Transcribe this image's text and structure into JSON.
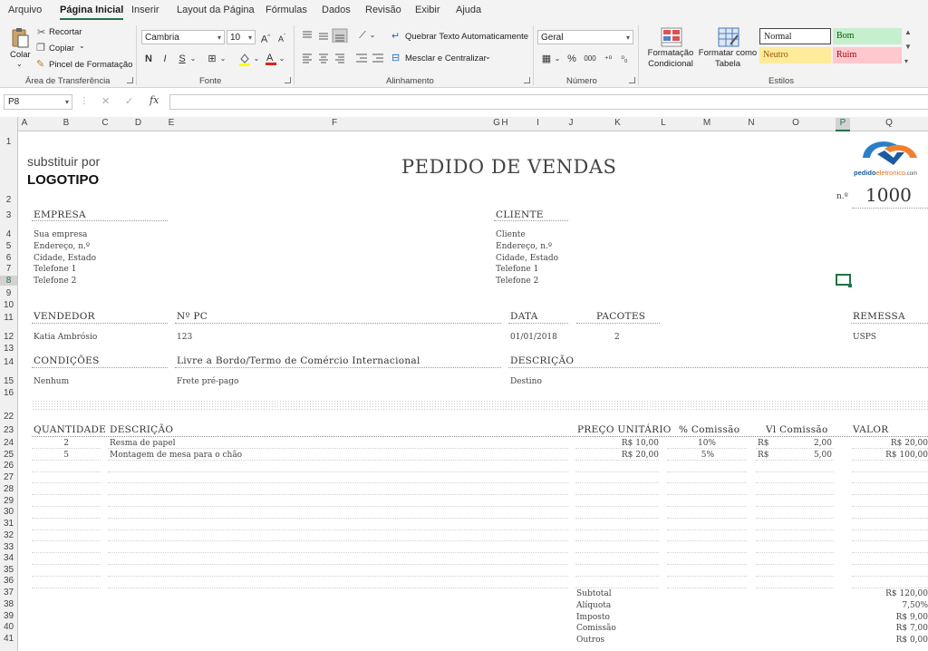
{
  "menu": {
    "tabs": [
      "Arquivo",
      "Página Inicial",
      "Inserir",
      "Layout da Página",
      "Fórmulas",
      "Dados",
      "Revisão",
      "Exibir",
      "Ajuda"
    ],
    "active": "Página Inicial"
  },
  "ribbon": {
    "clipboard": {
      "paste": "Colar",
      "cut": "Recortar",
      "copy": "Copiar",
      "painter": "Pincel de Formatação",
      "group": "Área de Transferência"
    },
    "font": {
      "name": "Cambria",
      "size": "10",
      "bold": "N",
      "italic": "I",
      "underline": "S",
      "group": "Fonte"
    },
    "alignment": {
      "wrap": "Quebrar Texto Automaticamente",
      "merge": "Mesclar e Centralizar",
      "group": "Alinhamento"
    },
    "number": {
      "format": "Geral",
      "group": "Número",
      "pct": "%",
      "thousands": "000"
    },
    "styles": {
      "cond": "Formatação Condicional",
      "table": "Formatar como Tabela",
      "normal": "Normal",
      "good": "Bom",
      "neutral": "Neutro",
      "bad": "Ruim",
      "group": "Estilos"
    }
  },
  "formula_bar": {
    "cell_ref": "P8",
    "content": ""
  },
  "columns": [
    "A",
    "B",
    "C",
    "D",
    "E",
    "F",
    "G",
    "H",
    "I",
    "J",
    "K",
    "L",
    "M",
    "N",
    "O",
    "P",
    "Q"
  ],
  "rows": [
    "1",
    "2",
    "3",
    "4",
    "5",
    "6",
    "7",
    "8",
    "9",
    "10",
    "11",
    "12",
    "13",
    "14",
    "15",
    "16",
    "22",
    "23",
    "24",
    "25",
    "26",
    "27",
    "28",
    "29",
    "30",
    "31",
    "32",
    "33",
    "34",
    "35",
    "36",
    "37",
    "38",
    "39",
    "40",
    "41"
  ],
  "sheet": {
    "logo_hint1": "substituir por",
    "logo_hint2": "LOGOTIPO",
    "title": "PEDIDO DE VENDAS",
    "brand": "pedido",
    "brand2": "eletronico",
    "brand3": ".com",
    "num_label": "n.º",
    "number": "1000",
    "empresa": {
      "label": "EMPRESA",
      "lines": [
        "Sua empresa",
        "Endereço, n.º",
        "Cidade, Estado",
        "Telefone 1",
        "Telefone 2"
      ]
    },
    "cliente": {
      "label": "CLIENTE",
      "lines": [
        "Cliente",
        "Endereço, n.º",
        "Cidade, Estado",
        "Telefone 1",
        "Telefone 2"
      ]
    },
    "vendedor": {
      "label": "VENDEDOR",
      "value": "Katia Ambrósio"
    },
    "npc": {
      "label": "Nº PC",
      "value": "123"
    },
    "data": {
      "label": "DATA",
      "value": "01/01/2018"
    },
    "pacotes": {
      "label": "PACOTES",
      "value": "2"
    },
    "remessa": {
      "label": "REMESSA",
      "value": "USPS"
    },
    "condicoes": {
      "label": "CONDIÇÕES",
      "value": "Nenhum"
    },
    "incoterm": {
      "label": "Livre a Bordo/Termo de Comércio Internacional",
      "value": "Frete pré-pago"
    },
    "descricao_top": {
      "label": "DESCRIÇÃO",
      "value": "Destino"
    },
    "table_headers": [
      "QUANTIDADE",
      "DESCRIÇÃO",
      "PREÇO UNITÁRIO",
      "% Comissão",
      "Vl Comissão",
      "VALOR"
    ],
    "items": [
      {
        "qty": "2",
        "desc": "Resma de papel",
        "price": "R$ 10,00",
        "pct": "10%",
        "cur": "R$",
        "vl": "2,00",
        "total": "R$ 20,00"
      },
      {
        "qty": "5",
        "desc": "Montagem de mesa para o chão",
        "price": "R$ 20,00",
        "pct": "5%",
        "cur": "R$",
        "vl": "5,00",
        "total": "R$ 100,00"
      }
    ],
    "totals": [
      {
        "label": "Subtotal",
        "value": "R$ 120,00"
      },
      {
        "label": "Alíquota",
        "value": "7,50%"
      },
      {
        "label": "Imposto",
        "value": "R$ 9,00"
      },
      {
        "label": "Comissão",
        "value": "R$ 7,00"
      },
      {
        "label": "Outros",
        "value": "R$ 0,00"
      }
    ]
  },
  "colors": {
    "accent": "#217346",
    "good_bg": "#c6efce",
    "good_fg": "#006100",
    "neutral_bg": "#ffeb9c",
    "neutral_fg": "#9c5700",
    "bad_bg": "#ffc7ce",
    "bad_fg": "#9c0006"
  }
}
